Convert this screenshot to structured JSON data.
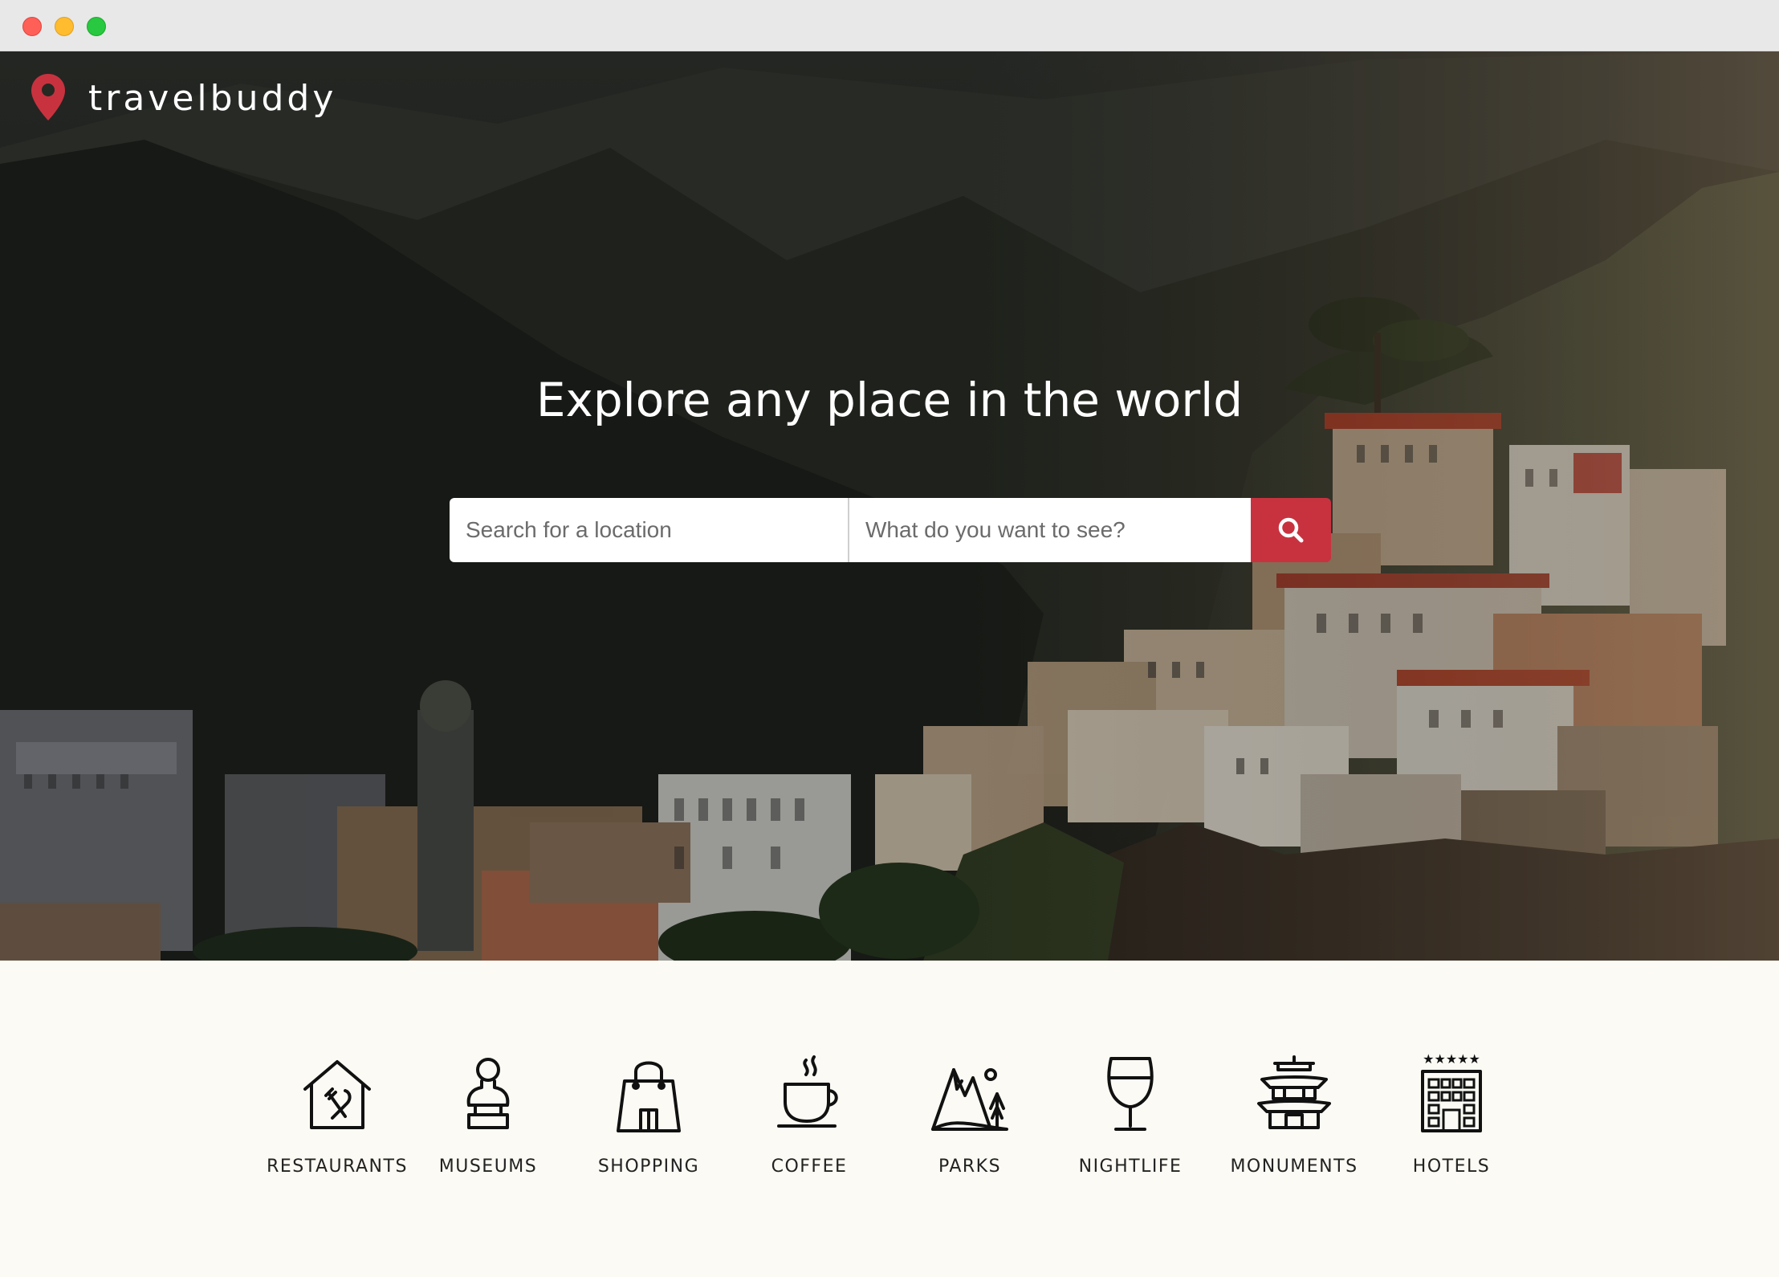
{
  "brand": {
    "name": "travelbuddy",
    "pin_color": "#c8323f"
  },
  "hero": {
    "headline": "Explore any place in the world"
  },
  "search": {
    "location_placeholder": "Search for a location",
    "query_placeholder": "What do you want to see?",
    "button_icon": "search-icon",
    "button_color": "#c8323f"
  },
  "categories": [
    {
      "label": "RESTAURANTS",
      "icon": "restaurant-icon"
    },
    {
      "label": "MUSEUMS",
      "icon": "museum-bust-icon"
    },
    {
      "label": "SHOPPING",
      "icon": "shopping-bag-icon"
    },
    {
      "label": "COFFEE",
      "icon": "coffee-cup-icon"
    },
    {
      "label": "PARKS",
      "icon": "mountains-trees-icon"
    },
    {
      "label": "NIGHTLIFE",
      "icon": "wine-glass-icon"
    },
    {
      "label": "MONUMENTS",
      "icon": "pagoda-icon"
    },
    {
      "label": "HOTELS",
      "icon": "hotel-building-icon"
    }
  ]
}
